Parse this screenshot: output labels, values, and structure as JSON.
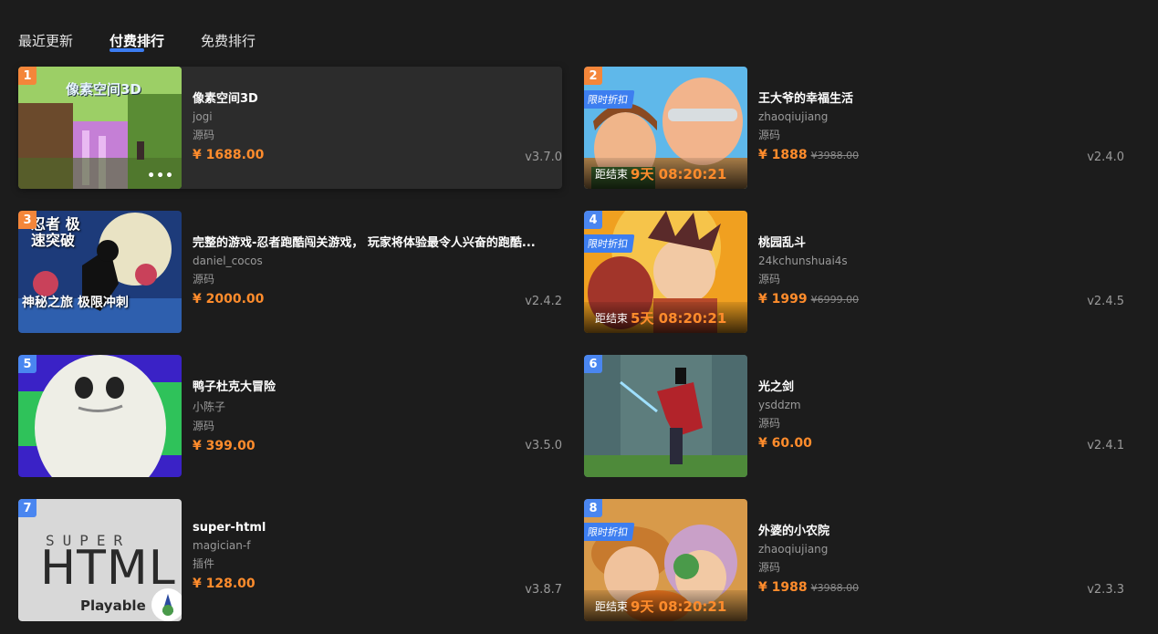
{
  "tabs": [
    {
      "label": "最近更新",
      "active": false
    },
    {
      "label": "付费排行",
      "active": true
    },
    {
      "label": "免费排行",
      "active": false
    }
  ],
  "colors": {
    "accent": "#3c7cf0",
    "price": "#ff8c2c",
    "rank_orange": "#f4863a",
    "rank_blue": "#4a86f0"
  },
  "items": [
    {
      "rank": "1",
      "title": "像素空间3D",
      "author": "jogi",
      "kind": "源码",
      "price": "¥ 1688.00",
      "version": "v3.7.0",
      "thumb_text": "像素空间3D",
      "more_icon": "more-dots-icon"
    },
    {
      "rank": "2",
      "title": "王大爷的幸福生活",
      "author": "zhaoqiujiang",
      "kind": "源码",
      "price": "¥ 1888",
      "orig_price": "¥3988.00",
      "version": "v2.4.0",
      "promo": "限时折扣",
      "countdown_label": "距结束",
      "countdown_value": "9天 08:20:21"
    },
    {
      "rank": "3",
      "title": "完整的游戏-忍者跑酷闯关游戏， 玩家将体验最令人兴奋的跑酷...",
      "author": "daniel_cocos",
      "kind": "源码",
      "price": "¥ 2000.00",
      "version": "v2.4.2",
      "thumb_text_top": "忍者 极速突破",
      "thumb_text_bottom": "神秘之旅 极限冲刺"
    },
    {
      "rank": "4",
      "title": "桃园乱斗",
      "author": "24kchunshuai4s",
      "kind": "源码",
      "price": "¥ 1999",
      "orig_price": "¥6999.00",
      "version": "v2.4.5",
      "promo": "限时折扣",
      "countdown_label": "距结束",
      "countdown_value": "5天 08:20:21"
    },
    {
      "rank": "5",
      "title": "鸭子杜克大冒险",
      "author": "小陈子",
      "kind": "源码",
      "price": "¥ 399.00",
      "version": "v3.5.0"
    },
    {
      "rank": "6",
      "title": "光之剑",
      "author": "ysddzm",
      "kind": "源码",
      "price": "¥ 60.00",
      "version": "v2.4.1"
    },
    {
      "rank": "7",
      "title": "super-html",
      "author": "magician-f",
      "kind": "插件",
      "price": "¥ 128.00",
      "version": "v3.8.7",
      "thumb_super": "SUPER",
      "thumb_html": "HTML",
      "thumb_playable": "Playable"
    },
    {
      "rank": "8",
      "title": "外婆的小农院",
      "author": "zhaoqiujiang",
      "kind": "源码",
      "price": "¥ 1988",
      "orig_price": "¥3988.00",
      "version": "v2.3.3",
      "promo": "限时折扣",
      "countdown_label": "距结束",
      "countdown_value": "9天 08:20:21"
    }
  ]
}
